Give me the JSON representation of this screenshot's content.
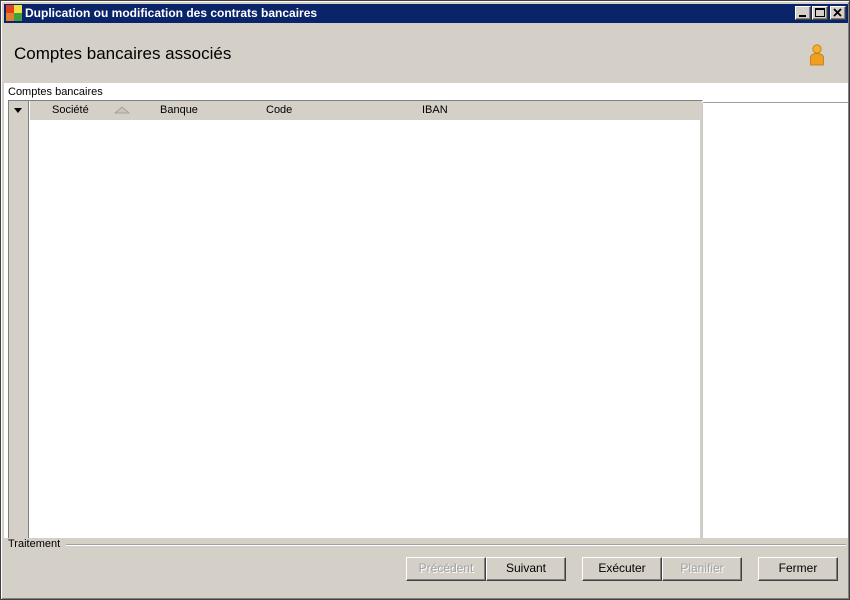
{
  "window": {
    "title": "Duplication ou modification des contrats bancaires",
    "controls": [
      "minimize-icon",
      "maximize-icon",
      "close-icon"
    ]
  },
  "header": {
    "title": "Comptes bancaires associés",
    "user_icon": "user-icon"
  },
  "section": {
    "label": "Comptes bancaires"
  },
  "grid": {
    "columns": [
      "Société",
      "Banque",
      "Code",
      "IBAN"
    ],
    "sorted_column": "Société",
    "sort_direction": "ascending",
    "rows": []
  },
  "footer": {
    "label": "Traitement",
    "buttons": {
      "previous": "Précédent",
      "next": "Suivant",
      "execute": "Exécuter",
      "schedule": "Planifier",
      "close": "Fermer"
    }
  },
  "colors": {
    "titlebar": "#0a246a",
    "chrome": "#d4d0c8",
    "user_icon": "#f0a020"
  }
}
